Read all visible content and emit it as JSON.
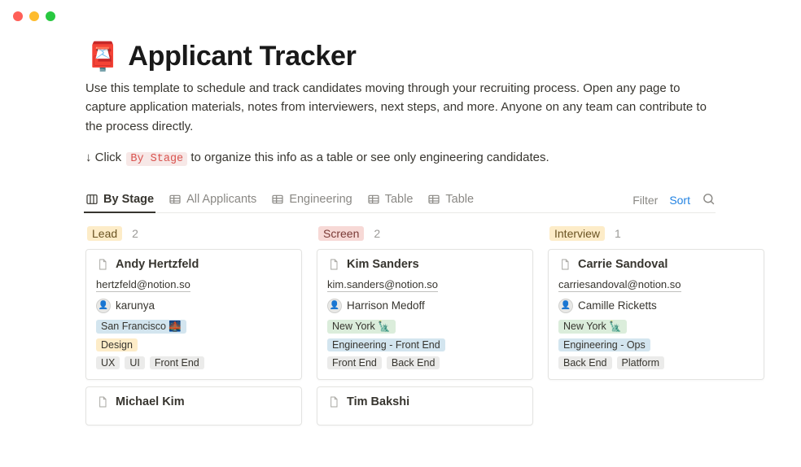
{
  "header": {
    "emoji": "📮",
    "title": "Applicant Tracker",
    "description": "Use this template to schedule and track candidates moving through your recruiting process. Open any page to capture application materials, notes from interviewers, next steps, and more. Anyone on any team can contribute to the process directly.",
    "hint_prefix": "↓ Click",
    "hint_code": "By Stage",
    "hint_suffix": "to organize this info as a table or see only engineering candidates."
  },
  "tabs": {
    "items": [
      {
        "label": "By Stage",
        "icon": "board",
        "active": true
      },
      {
        "label": "All Applicants",
        "icon": "table",
        "active": false
      },
      {
        "label": "Engineering",
        "icon": "table",
        "active": false
      },
      {
        "label": "Table",
        "icon": "table",
        "active": false
      },
      {
        "label": "Table",
        "icon": "table",
        "active": false
      }
    ],
    "actions": {
      "filter": "Filter",
      "sort": "Sort"
    }
  },
  "board": {
    "columns": [
      {
        "title": "Lead",
        "count": "2",
        "style": "lead",
        "cards": [
          {
            "name": "Andy Hertzfeld",
            "email": "hertzfeld@notion.so",
            "person": "karunya",
            "location": {
              "text": "San Francisco 🌉",
              "color": "blue"
            },
            "role": {
              "text": "Design",
              "color": "orange"
            },
            "skills": [
              {
                "text": "UX",
                "color": "gray"
              },
              {
                "text": "UI",
                "color": "gray"
              },
              {
                "text": "Front End",
                "color": "gray"
              }
            ]
          },
          {
            "name": "Michael Kim"
          }
        ]
      },
      {
        "title": "Screen",
        "count": "2",
        "style": "screen",
        "cards": [
          {
            "name": "Kim Sanders",
            "email": "kim.sanders@notion.so",
            "person": "Harrison Medoff",
            "location": {
              "text": "New York 🗽",
              "color": "green"
            },
            "role": {
              "text": "Engineering - Front End",
              "color": "blue"
            },
            "skills": [
              {
                "text": "Front End",
                "color": "gray"
              },
              {
                "text": "Back End",
                "color": "gray"
              }
            ]
          },
          {
            "name": "Tim Bakshi"
          }
        ]
      },
      {
        "title": "Interview",
        "count": "1",
        "style": "interview",
        "cards": [
          {
            "name": "Carrie Sandoval",
            "email": "carriesandoval@notion.so",
            "person": "Camille Ricketts",
            "location": {
              "text": "New York 🗽",
              "color": "green"
            },
            "role": {
              "text": "Engineering - Ops",
              "color": "blue"
            },
            "skills": [
              {
                "text": "Back End",
                "color": "gray"
              },
              {
                "text": "Platform",
                "color": "gray"
              }
            ]
          }
        ]
      }
    ]
  }
}
